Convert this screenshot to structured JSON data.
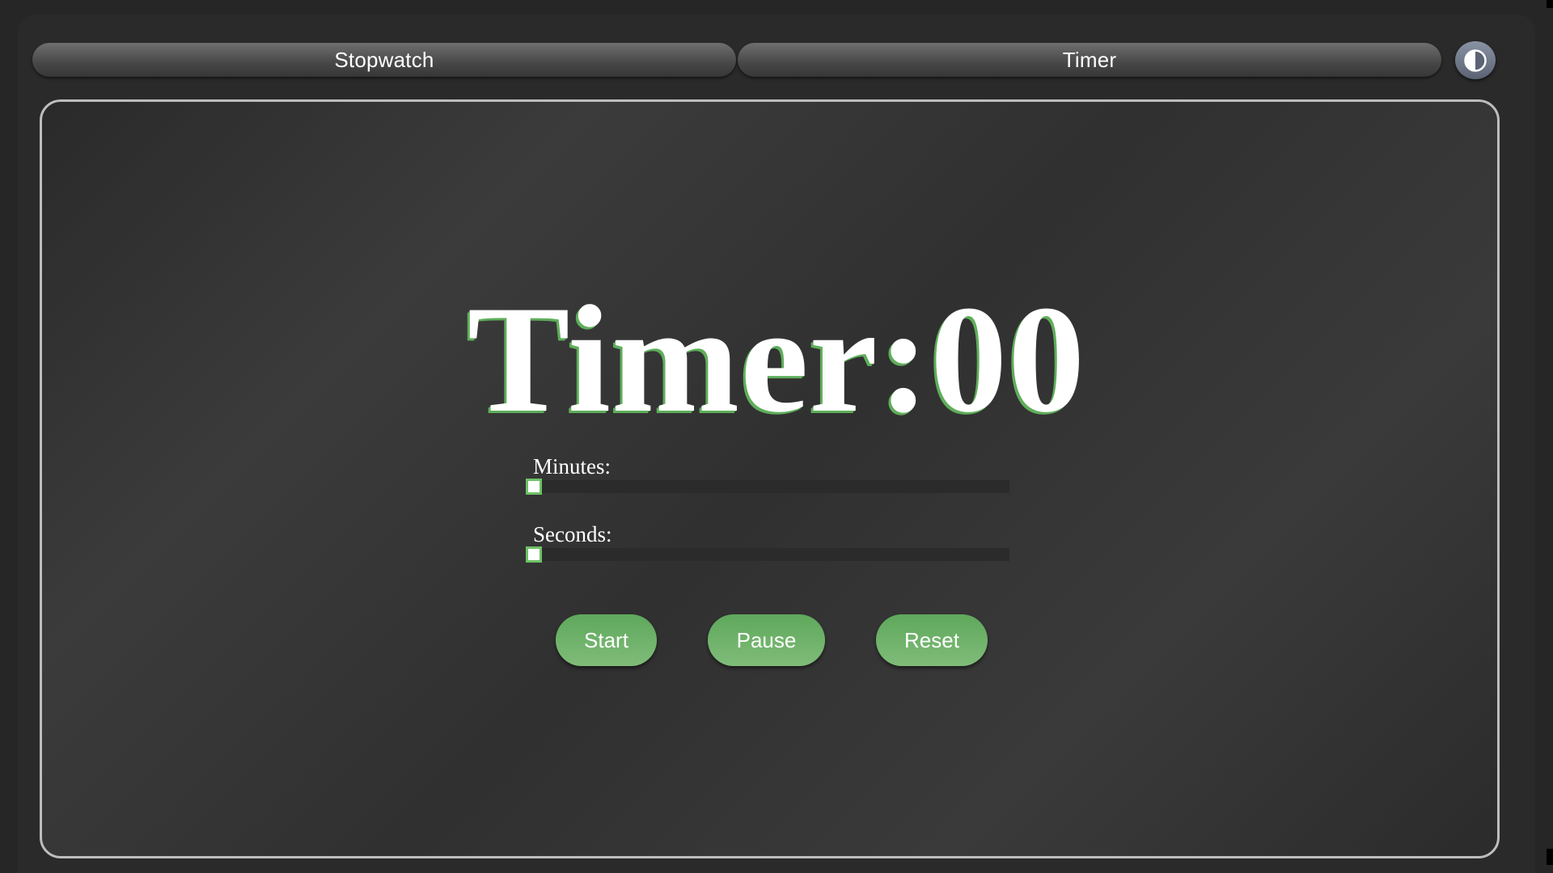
{
  "tabs": [
    {
      "label": "Stopwatch"
    },
    {
      "label": "Timer"
    }
  ],
  "theme_toggle": {
    "icon": "contrast-icon"
  },
  "display": {
    "text": "Timer:00"
  },
  "minutes": {
    "label": "Minutes:",
    "value": 0
  },
  "seconds": {
    "label": "Seconds:",
    "value": 0
  },
  "buttons": {
    "start": "Start",
    "pause": "Pause",
    "reset": "Reset"
  },
  "colors": {
    "accent": "#6dc265",
    "button": "#6cb267",
    "panel_border": "#bdbdbd",
    "background": "#2a2a2a"
  }
}
